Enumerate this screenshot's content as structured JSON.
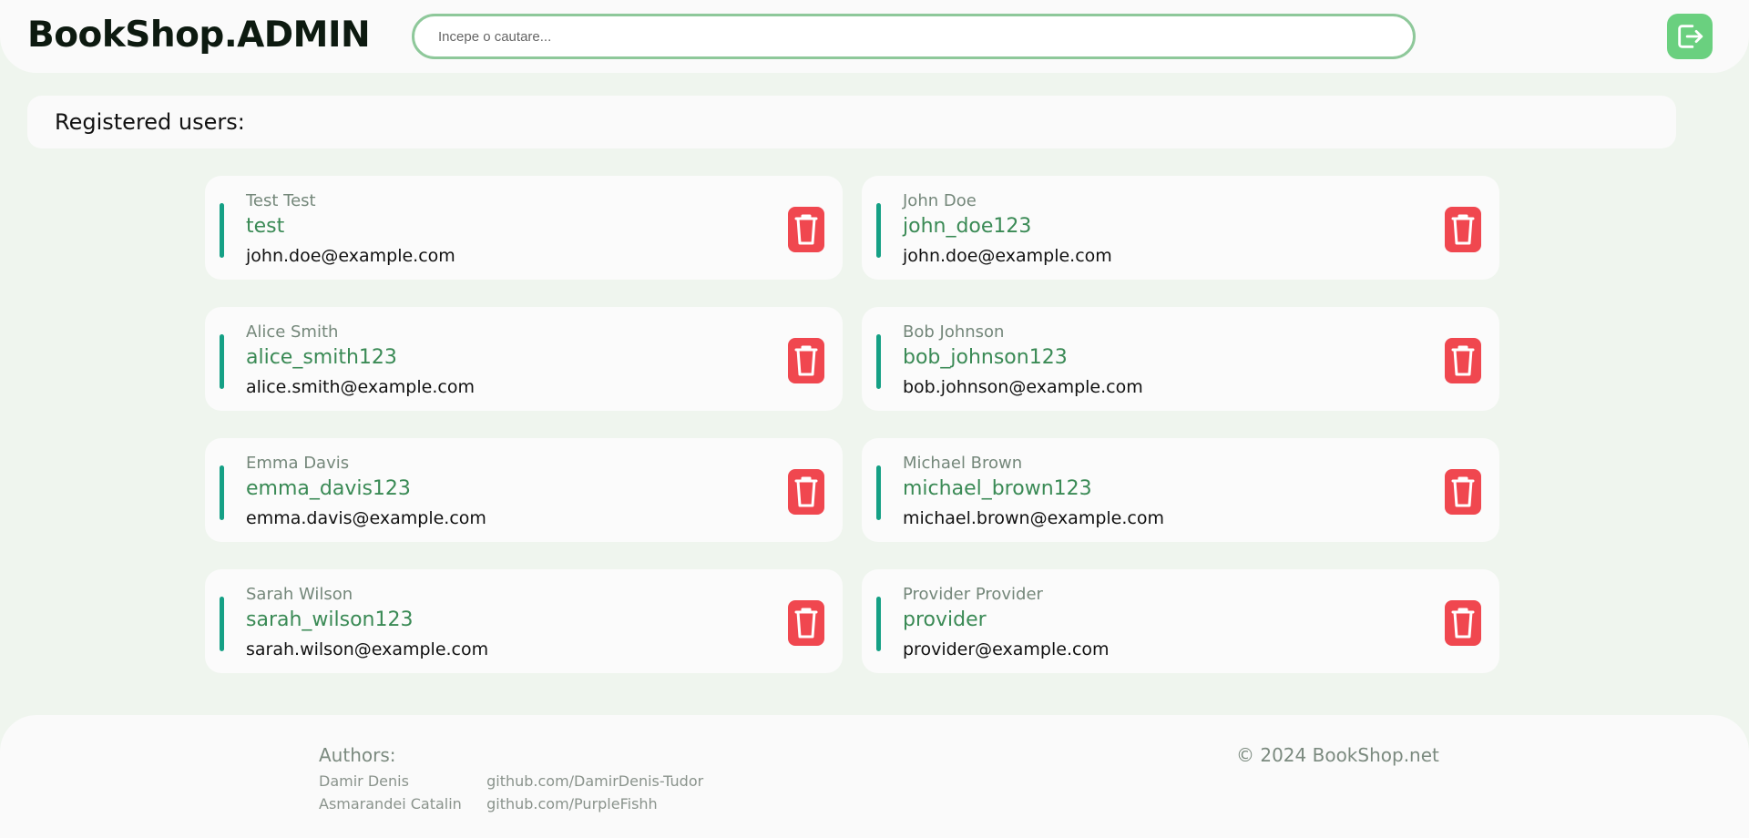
{
  "header": {
    "brand": "BookShop.ADMIN",
    "search_placeholder": "Incepe o cautare...",
    "logout_icon": "logout-icon"
  },
  "page": {
    "title": "Registered users:"
  },
  "users": [
    {
      "name": "Test Test",
      "username": "test",
      "email": "john.doe@example.com"
    },
    {
      "name": "John Doe",
      "username": "john_doe123",
      "email": "john.doe@example.com"
    },
    {
      "name": "Alice Smith",
      "username": "alice_smith123",
      "email": "alice.smith@example.com"
    },
    {
      "name": "Bob Johnson",
      "username": "bob_johnson123",
      "email": "bob.johnson@example.com"
    },
    {
      "name": "Emma Davis",
      "username": "emma_davis123",
      "email": "emma.davis@example.com"
    },
    {
      "name": "Michael Brown",
      "username": "michael_brown123",
      "email": "michael.brown@example.com"
    },
    {
      "name": "Sarah Wilson",
      "username": "sarah_wilson123",
      "email": "sarah.wilson@example.com"
    },
    {
      "name": "Provider Provider",
      "username": "provider",
      "email": "provider@example.com"
    }
  ],
  "footer": {
    "authors_title": "Authors:",
    "authors": [
      {
        "name": "Damir Denis",
        "link": "github.com/DamirDenis-Tudor"
      },
      {
        "name": "Asmarandei Catalin",
        "link": "github.com/PurpleFishh"
      }
    ],
    "copyright": "© 2024 BookShop.net"
  },
  "colors": {
    "background": "#eff5ee",
    "accent_green": "#6ad07f",
    "username_green": "#3a8a55",
    "accent_bar": "#15a085",
    "delete_red": "#f0474f"
  }
}
